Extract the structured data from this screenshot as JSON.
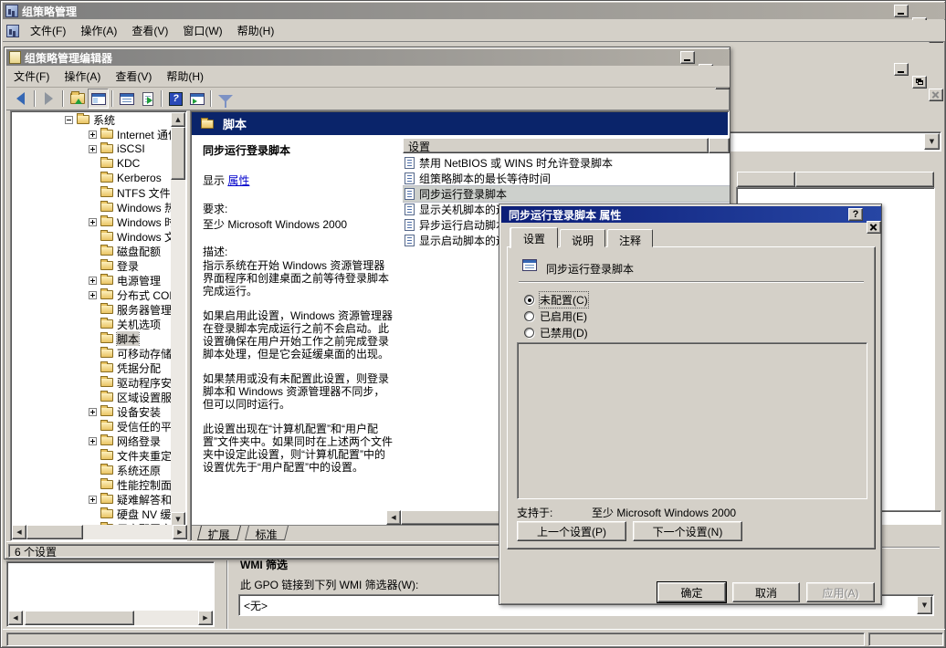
{
  "root_window": {
    "title": "组策略管理",
    "menu_items": [
      {
        "label": "文件(F)",
        "name": "menu-file"
      },
      {
        "label": "操作(A)",
        "name": "menu-action"
      },
      {
        "label": "查看(V)",
        "name": "menu-view"
      },
      {
        "label": "窗口(W)",
        "name": "menu-window"
      },
      {
        "label": "帮助(H)",
        "name": "menu-help"
      }
    ]
  },
  "console": {
    "wmi_section": {
      "title": "WMI 筛选",
      "label": "此 GPO 链接到下列 WMI 筛选器(W):",
      "filter_value": "<无>"
    }
  },
  "editor": {
    "title": "组策略管理编辑器",
    "menu_items": [
      {
        "label": "文件(F)",
        "name": "menu-file"
      },
      {
        "label": "操作(A)",
        "name": "menu-action"
      },
      {
        "label": "查看(V)",
        "name": "menu-view"
      },
      {
        "label": "帮助(H)",
        "name": "menu-help"
      }
    ],
    "toolbar": [
      {
        "icon": "back-icon",
        "name": "back-button"
      },
      {
        "icon": "sep",
        "name": "toolbar-separator"
      },
      {
        "icon": "forward-icon",
        "name": "forward-button"
      },
      {
        "icon": "sep",
        "name": "toolbar-separator"
      },
      {
        "icon": "up-one-level-icon",
        "name": "up-one-level-button"
      },
      {
        "icon": "console-tree-icon",
        "name": "show-console-tree-button",
        "pressed": true
      },
      {
        "icon": "sep",
        "name": "toolbar-separator"
      },
      {
        "icon": "properties-icon",
        "name": "properties-button"
      },
      {
        "icon": "export-list-icon",
        "name": "export-list-button"
      },
      {
        "icon": "sep",
        "name": "toolbar-separator"
      },
      {
        "icon": "help-icon",
        "name": "help-button"
      },
      {
        "icon": "extended-view-icon",
        "name": "extended-view-button"
      },
      {
        "icon": "sep",
        "name": "toolbar-separator"
      },
      {
        "icon": "filter-icon",
        "name": "filter-button"
      }
    ],
    "tree_items": [
      {
        "label": "系统",
        "level": 0,
        "expander": "minus"
      },
      {
        "label": "Internet 通信管理",
        "level": 1,
        "expander": "plus"
      },
      {
        "label": "iSCSI",
        "level": 1,
        "expander": "plus"
      },
      {
        "label": "KDC",
        "level": 1
      },
      {
        "label": "Kerberos",
        "level": 1
      },
      {
        "label": "NTFS 文件系统",
        "level": 1
      },
      {
        "label": "Windows 热启动",
        "level": 1
      },
      {
        "label": "Windows 时间服务",
        "level": 1,
        "expander": "plus"
      },
      {
        "label": "Windows 文件保护",
        "level": 1
      },
      {
        "label": "磁盘配额",
        "level": 1
      },
      {
        "label": "登录",
        "level": 1
      },
      {
        "label": "电源管理",
        "level": 1,
        "expander": "plus"
      },
      {
        "label": "分布式 COM",
        "level": 1,
        "expander": "plus"
      },
      {
        "label": "服务器管理器",
        "level": 1
      },
      {
        "label": "关机选项",
        "level": 1
      },
      {
        "label": "脚本",
        "level": 1,
        "selected": true
      },
      {
        "label": "可移动存储访问",
        "level": 1
      },
      {
        "label": "凭据分配",
        "level": 1
      },
      {
        "label": "驱动程序安装",
        "level": 1
      },
      {
        "label": "区域设置服务",
        "level": 1
      },
      {
        "label": "设备安装",
        "level": 1,
        "expander": "plus"
      },
      {
        "label": "受信任的平台模块服务",
        "level": 1
      },
      {
        "label": "网络登录",
        "level": 1,
        "expander": "plus"
      },
      {
        "label": "文件夹重定向",
        "level": 1
      },
      {
        "label": "系统还原",
        "level": 1
      },
      {
        "label": "性能控制面板",
        "level": 1
      },
      {
        "label": "疑难解答和诊断",
        "level": 1,
        "expander": "plus"
      },
      {
        "label": "硬盘 NV 缓存",
        "level": 1
      },
      {
        "label": "用户配置文件",
        "level": 1
      }
    ],
    "extended_view": {
      "header": "脚本",
      "detail_title": "同步运行登录脚本",
      "display_label": "显示",
      "properties_link": "属性",
      "requirements_label": "要求:",
      "requirements_value": "至少 Microsoft Windows 2000",
      "description_label": "描述:",
      "description_paragraphs": [
        {
          "text": "指示系统在开始 Windows 资源管理器界面程序和创建桌面之前等待登录脚本完成运行。"
        },
        {
          "text": "如果启用此设置，Windows 资源管理器在登录脚本完成运行之前不会启动。此设置确保在用户开始工作之前完成登录脚本处理，但是它会延缓桌面的出现。"
        },
        {
          "text": "如果禁用或没有未配置此设置，则登录脚本和 Windows 资源管理器不同步，但可以同时运行。"
        },
        {
          "text": "此设置出现在“计算机配置”和“用户配置”文件夹中。如果同时在上述两个文件夹中设定此设置，则“计算机配置”中的设置优先于“用户配置”中的设置。"
        }
      ],
      "list_header": "设置",
      "settings": [
        {
          "label": "禁用 NetBIOS 或 WINS 时允许登录脚本"
        },
        {
          "label": "组策略脚本的最长等待时间"
        },
        {
          "label": "同步运行登录脚本",
          "selected": true
        },
        {
          "label": "显示关机脚本的运行"
        },
        {
          "label": "异步运行启动脚本"
        },
        {
          "label": "显示启动脚本的运行"
        }
      ],
      "bottom_tabs": [
        {
          "label": "扩展",
          "active": true
        },
        {
          "label": "标准"
        }
      ]
    },
    "status_text": "6 个设置"
  },
  "dialog": {
    "title": "同步运行登录脚本 属性",
    "tabs": [
      {
        "label": "设置",
        "active": true
      },
      {
        "label": "说明"
      },
      {
        "label": "注释"
      }
    ],
    "setting_name": "同步运行登录脚本",
    "radio_options": [
      {
        "label": "未配置(C)",
        "checked": true
      },
      {
        "label": "已启用(E)"
      },
      {
        "label": "已禁用(D)"
      }
    ],
    "supported_on_label": "支持于:",
    "supported_on_value": "至少 Microsoft Windows 2000",
    "previous_button": "上一个设置(P)",
    "next_button": "下一个设置(N)",
    "ok_button": "确定",
    "cancel_button": "取消",
    "apply_button": "应用(A)"
  },
  "colors": {
    "active_title": "#0c1e78",
    "inactive_title": "#7d7d7d",
    "header_navy": "#0a246a",
    "selection_gray": "#cdd0cc",
    "chrome": "#d4d0c8"
  }
}
